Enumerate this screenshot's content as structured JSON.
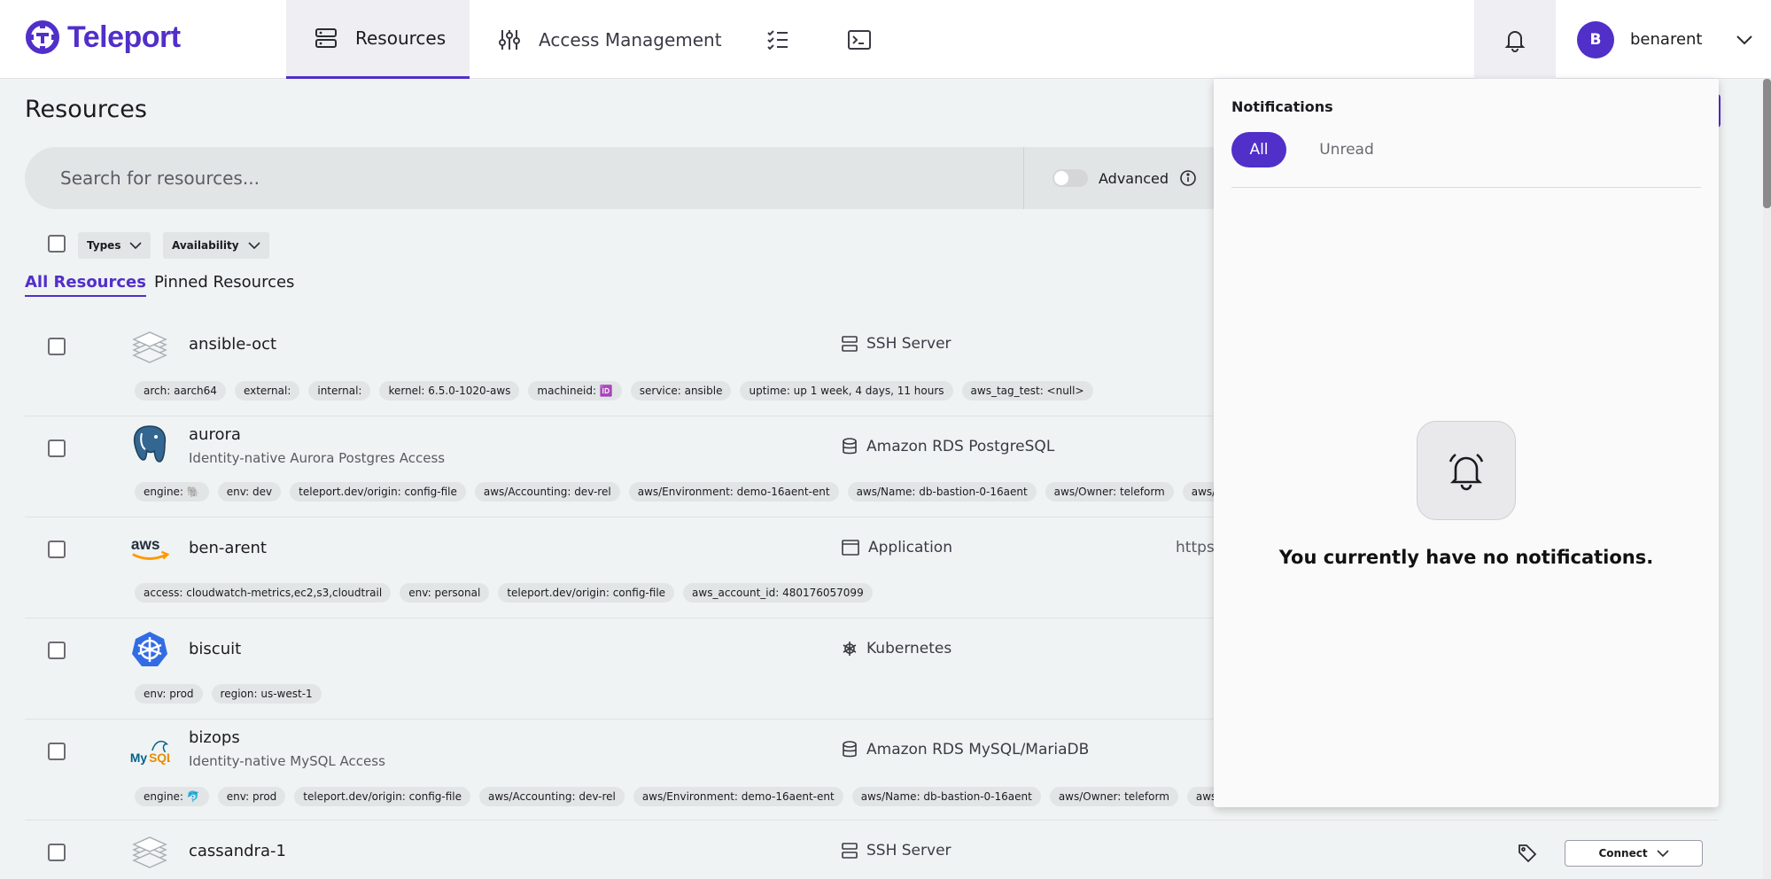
{
  "brand": {
    "name": "Teleport",
    "color": "#512fc9"
  },
  "nav": {
    "resources": "Resources",
    "access_management": "Access Management"
  },
  "user": {
    "initial": "B",
    "name": "benarent"
  },
  "page": {
    "title": "Resources"
  },
  "search": {
    "placeholder": "Search for resources..."
  },
  "advanced": {
    "label": "Advanced"
  },
  "filters": {
    "types": "Types",
    "availability": "Availability"
  },
  "tabs": {
    "all": "All Resources",
    "pinned": "Pinned Resources"
  },
  "rows": [
    {
      "name": "ansible-oct",
      "desc": "",
      "kind": "SSH Server",
      "icon": "server-stack-icon",
      "url": "",
      "labels": [
        "arch: aarch64",
        "external:",
        "internal:",
        "kernel: 6.5.0-1020-aws",
        "machineid: 🆔",
        "service: ansible",
        "uptime: up 1 week, 4 days, 11 hours",
        "aws_tag_test: <null>"
      ]
    },
    {
      "name": "aurora",
      "desc": "Identity-native Aurora Postgres Access",
      "kind": "Amazon RDS PostgreSQL",
      "icon": "postgres-icon",
      "url": "",
      "labels": [
        "engine: 🐘",
        "env: dev",
        "teleport.dev/origin: config-file",
        "aws/Accounting: dev-rel",
        "aws/Environment: demo-16aent-ent",
        "aws/Name: db-bastion-0-16aent",
        "aws/Owner: teleform",
        "aws/Service"
      ]
    },
    {
      "name": "ben-arent",
      "desc": "",
      "kind": "Application",
      "icon": "aws-icon",
      "url": "https",
      "labels": [
        "access: cloudwatch-metrics,ec2,s3,cloudtrail",
        "env: personal",
        "teleport.dev/origin: config-file",
        "aws_account_id: 480176057099"
      ]
    },
    {
      "name": "biscuit",
      "desc": "",
      "kind": "Kubernetes",
      "icon": "kubernetes-icon",
      "url": "",
      "labels": [
        "env: prod",
        "region: us-west-1"
      ]
    },
    {
      "name": "bizops",
      "desc": "Identity-native MySQL Access",
      "kind": "Amazon RDS MySQL/MariaDB",
      "icon": "mysql-icon",
      "url": "",
      "labels": [
        "engine: 🐬",
        "env: prod",
        "teleport.dev/origin: config-file",
        "aws/Accounting: dev-rel",
        "aws/Environment: demo-16aent-ent",
        "aws/Name: db-bastion-0-16aent",
        "aws/Owner: teleform",
        "aws/Servic"
      ]
    },
    {
      "name": "cassandra-1",
      "desc": "",
      "kind": "SSH Server",
      "icon": "server-stack-icon",
      "url": "",
      "labels": []
    }
  ],
  "connect": {
    "label": "Connect"
  },
  "notifications": {
    "title": "Notifications",
    "tab_all": "All",
    "tab_unread": "Unread",
    "empty": "You currently have no notifications."
  }
}
